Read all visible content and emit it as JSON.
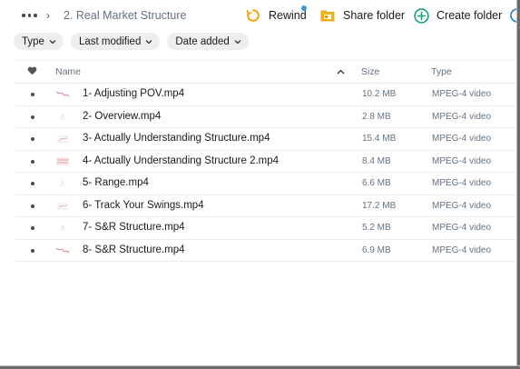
{
  "breadcrumb": {
    "more_label": "More",
    "title": "2. Real Market Structure"
  },
  "actions": {
    "rewind": "Rewind",
    "share_folder": "Share folder",
    "create_folder": "Create folder"
  },
  "filters": [
    {
      "label": "Type"
    },
    {
      "label": "Last modified"
    },
    {
      "label": "Date added"
    }
  ],
  "columns": {
    "name": "Name",
    "size": "Size",
    "type": "Type"
  },
  "files": [
    {
      "name": "1- Adjusting POV.mp4",
      "size": "10.2 MB",
      "type": "MPEG-4 video",
      "thumb": "red-line"
    },
    {
      "name": "2- Overview.mp4",
      "size": "2.8 MB",
      "type": "MPEG-4 video",
      "thumb": "faint"
    },
    {
      "name": "3- Actually Understanding Structure.mp4",
      "size": "15.4 MB",
      "type": "MPEG-4 video",
      "thumb": "grid"
    },
    {
      "name": "4- Actually Understanding Structure 2.mp4",
      "size": "8.4 MB",
      "type": "MPEG-4 video",
      "thumb": "red-grid"
    },
    {
      "name": "5- Range.mp4",
      "size": "6.6 MB",
      "type": "MPEG-4 video",
      "thumb": "faint"
    },
    {
      "name": "6- Track Your Swings.mp4",
      "size": "17.2 MB",
      "type": "MPEG-4 video",
      "thumb": "grid"
    },
    {
      "name": "7- S&R Structure.mp4",
      "size": "5.2 MB",
      "type": "MPEG-4 video",
      "thumb": "faint"
    },
    {
      "name": "8- S&R Structure.mp4",
      "size": "6.9 MB",
      "type": "MPEG-4 video",
      "thumb": "red-line"
    }
  ],
  "colors": {
    "rewind_icon": "#f0a30a",
    "share_icon": "#f0a30a",
    "create_icon": "#12a37a",
    "notification": "#3a9bdc",
    "secondary_text": "#637282"
  }
}
